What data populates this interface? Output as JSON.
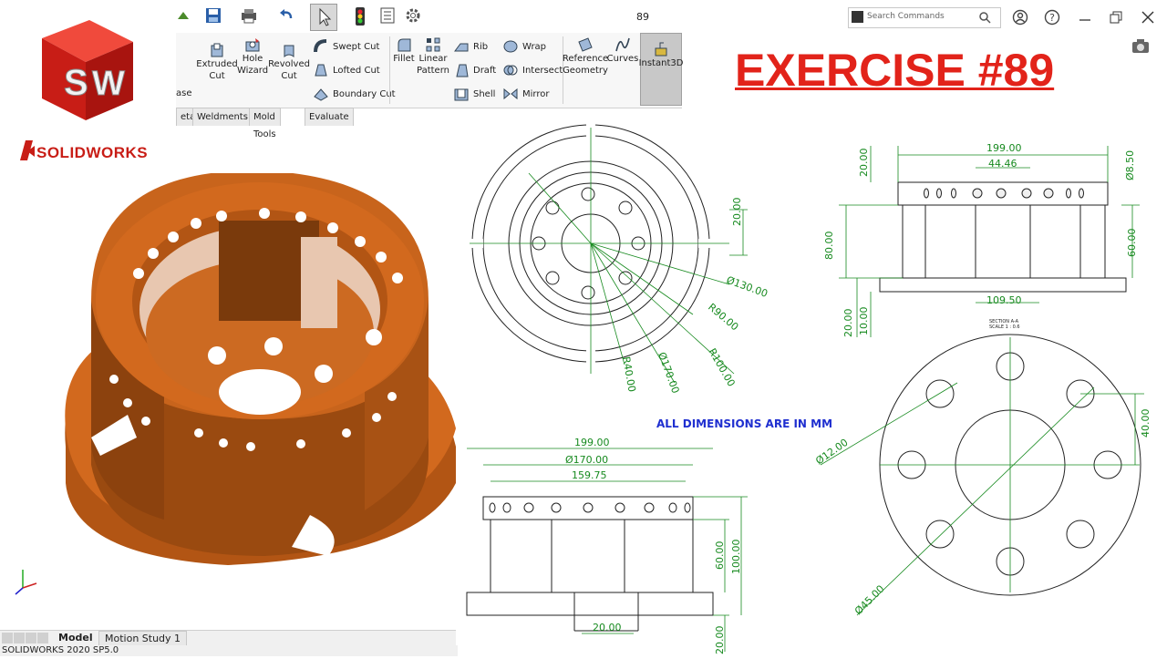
{
  "window": {
    "title": "89",
    "search_placeholder": "Search Commands"
  },
  "logo": {
    "brand": "SOLIDWORKS",
    "badge_letters": "SW"
  },
  "ribbon": {
    "partial_left": "ase",
    "buttons": [
      {
        "label": "Extruded Cut",
        "icon": "extruded-cut-icon"
      },
      {
        "label": "Hole Wizard",
        "icon": "hole-wizard-icon"
      },
      {
        "label": "Revolved Cut",
        "icon": "revolved-cut-icon"
      },
      {
        "label": "Swept Cut",
        "icon": "swept-cut-icon"
      },
      {
        "label": "Lofted Cut",
        "icon": "lofted-cut-icon"
      },
      {
        "label": "Boundary Cut",
        "icon": "boundary-cut-icon"
      },
      {
        "label": "Fillet",
        "icon": "fillet-icon"
      },
      {
        "label": "Linear Pattern",
        "icon": "linear-pattern-icon"
      },
      {
        "label": "Rib",
        "icon": "rib-icon"
      },
      {
        "label": "Draft",
        "icon": "draft-icon"
      },
      {
        "label": "Shell",
        "icon": "shell-icon"
      },
      {
        "label": "Wrap",
        "icon": "wrap-icon"
      },
      {
        "label": "Intersect",
        "icon": "intersect-icon"
      },
      {
        "label": "Mirror",
        "icon": "mirror-icon"
      },
      {
        "label": "Reference Geometry",
        "icon": "reference-geometry-icon"
      },
      {
        "label": "Curves",
        "icon": "curves-icon"
      },
      {
        "label": "Instant3D",
        "icon": "instant3d-icon"
      }
    ]
  },
  "command_tabs": [
    "etal",
    "Weldments",
    "Mold Tools",
    "Evaluate"
  ],
  "bottom_tabs": {
    "model": "Model",
    "motion": "Motion Study 1"
  },
  "status": "SOLIDWORKS 2020 SP5.0",
  "overlay": {
    "exercise_title": "EXERCISE #89",
    "units_note": "ALL DIMENSIONS ARE IN MM"
  },
  "dimensions": {
    "top_view": [
      "20.00",
      "Ø130.00",
      "R90.00",
      "R100.00",
      "Ø170.00",
      "R40.00"
    ],
    "side_view": [
      "199.00",
      "44.46",
      "Ø8.50",
      "20.00",
      "80.00",
      "60.00",
      "109.50",
      "20.00",
      "10.00"
    ],
    "front_view": [
      "199.00",
      "Ø170.00",
      "159.75",
      "60.00",
      "100.00",
      "20.00",
      "20.00"
    ],
    "detail_view": [
      "40.00",
      "Ø12.00",
      "Ø45.00"
    ],
    "section_label": "SECTION A-A",
    "scale_label": "SCALE 1 : 0.6"
  },
  "colors": {
    "accent_red": "#e2231a",
    "model_orange": "#d2691e",
    "dimension_green": "#178a1f",
    "note_blue": "#1f2fd0"
  }
}
